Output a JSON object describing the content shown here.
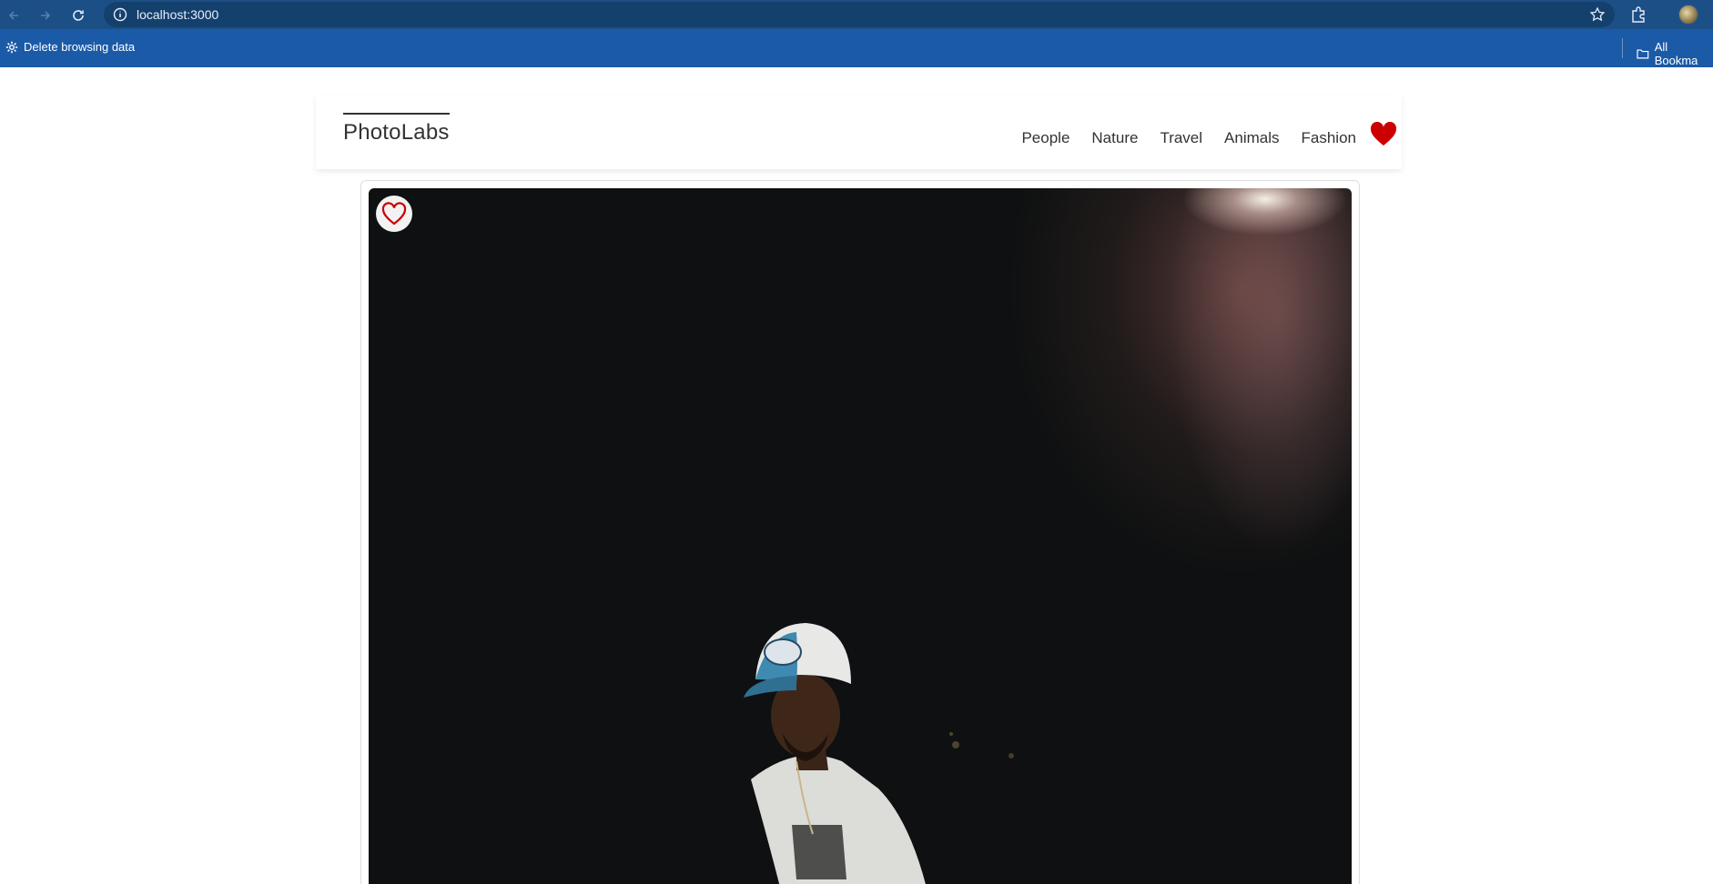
{
  "browser": {
    "url": "localhost:3000",
    "bookmarks": {
      "left_item": "Delete browsing data",
      "right_item": "All Bookma"
    }
  },
  "app": {
    "logo": "PhotoLabs",
    "topics": [
      "People",
      "Nature",
      "Travel",
      "Animals",
      "Fashion"
    ],
    "accent_color": "#cc0000"
  },
  "photo": {
    "favourited": false,
    "subject": "man in blue cap and white t-shirt at night"
  }
}
